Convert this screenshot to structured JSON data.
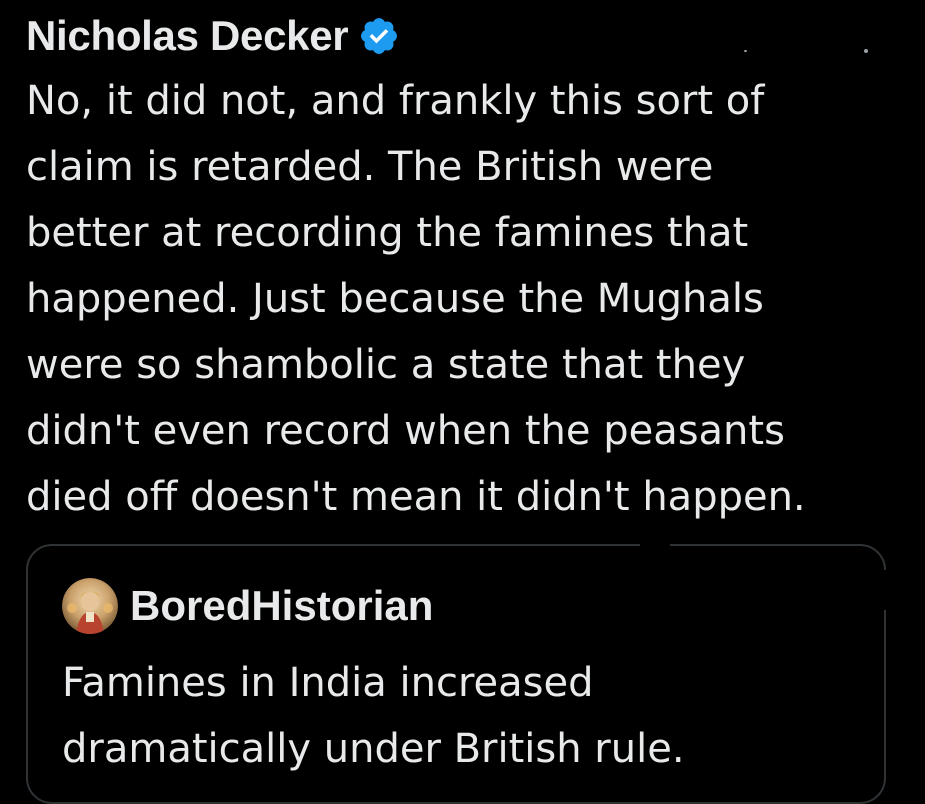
{
  "tweet": {
    "author_name": "Nicholas Decker",
    "verified_icon": "verified-badge-icon",
    "text": "No, it did not, and frankly this sort of\nclaim is retarded. The British were\nbetter at recording the famines that\nhappened. Just because the Mughals\nwere so shambolic a state that they\ndidn't even record when the peasants\ndied off doesn't mean it didn't happen."
  },
  "quoted_tweet": {
    "author_name": "BoredHistorian",
    "avatar_icon": "avatar-icon",
    "text": "Famines in India increased\ndramatically under British rule."
  },
  "colors": {
    "background": "#000000",
    "text": "#e7e9ea",
    "verified": "#1d9bf0",
    "card_border": "#2f3336"
  }
}
